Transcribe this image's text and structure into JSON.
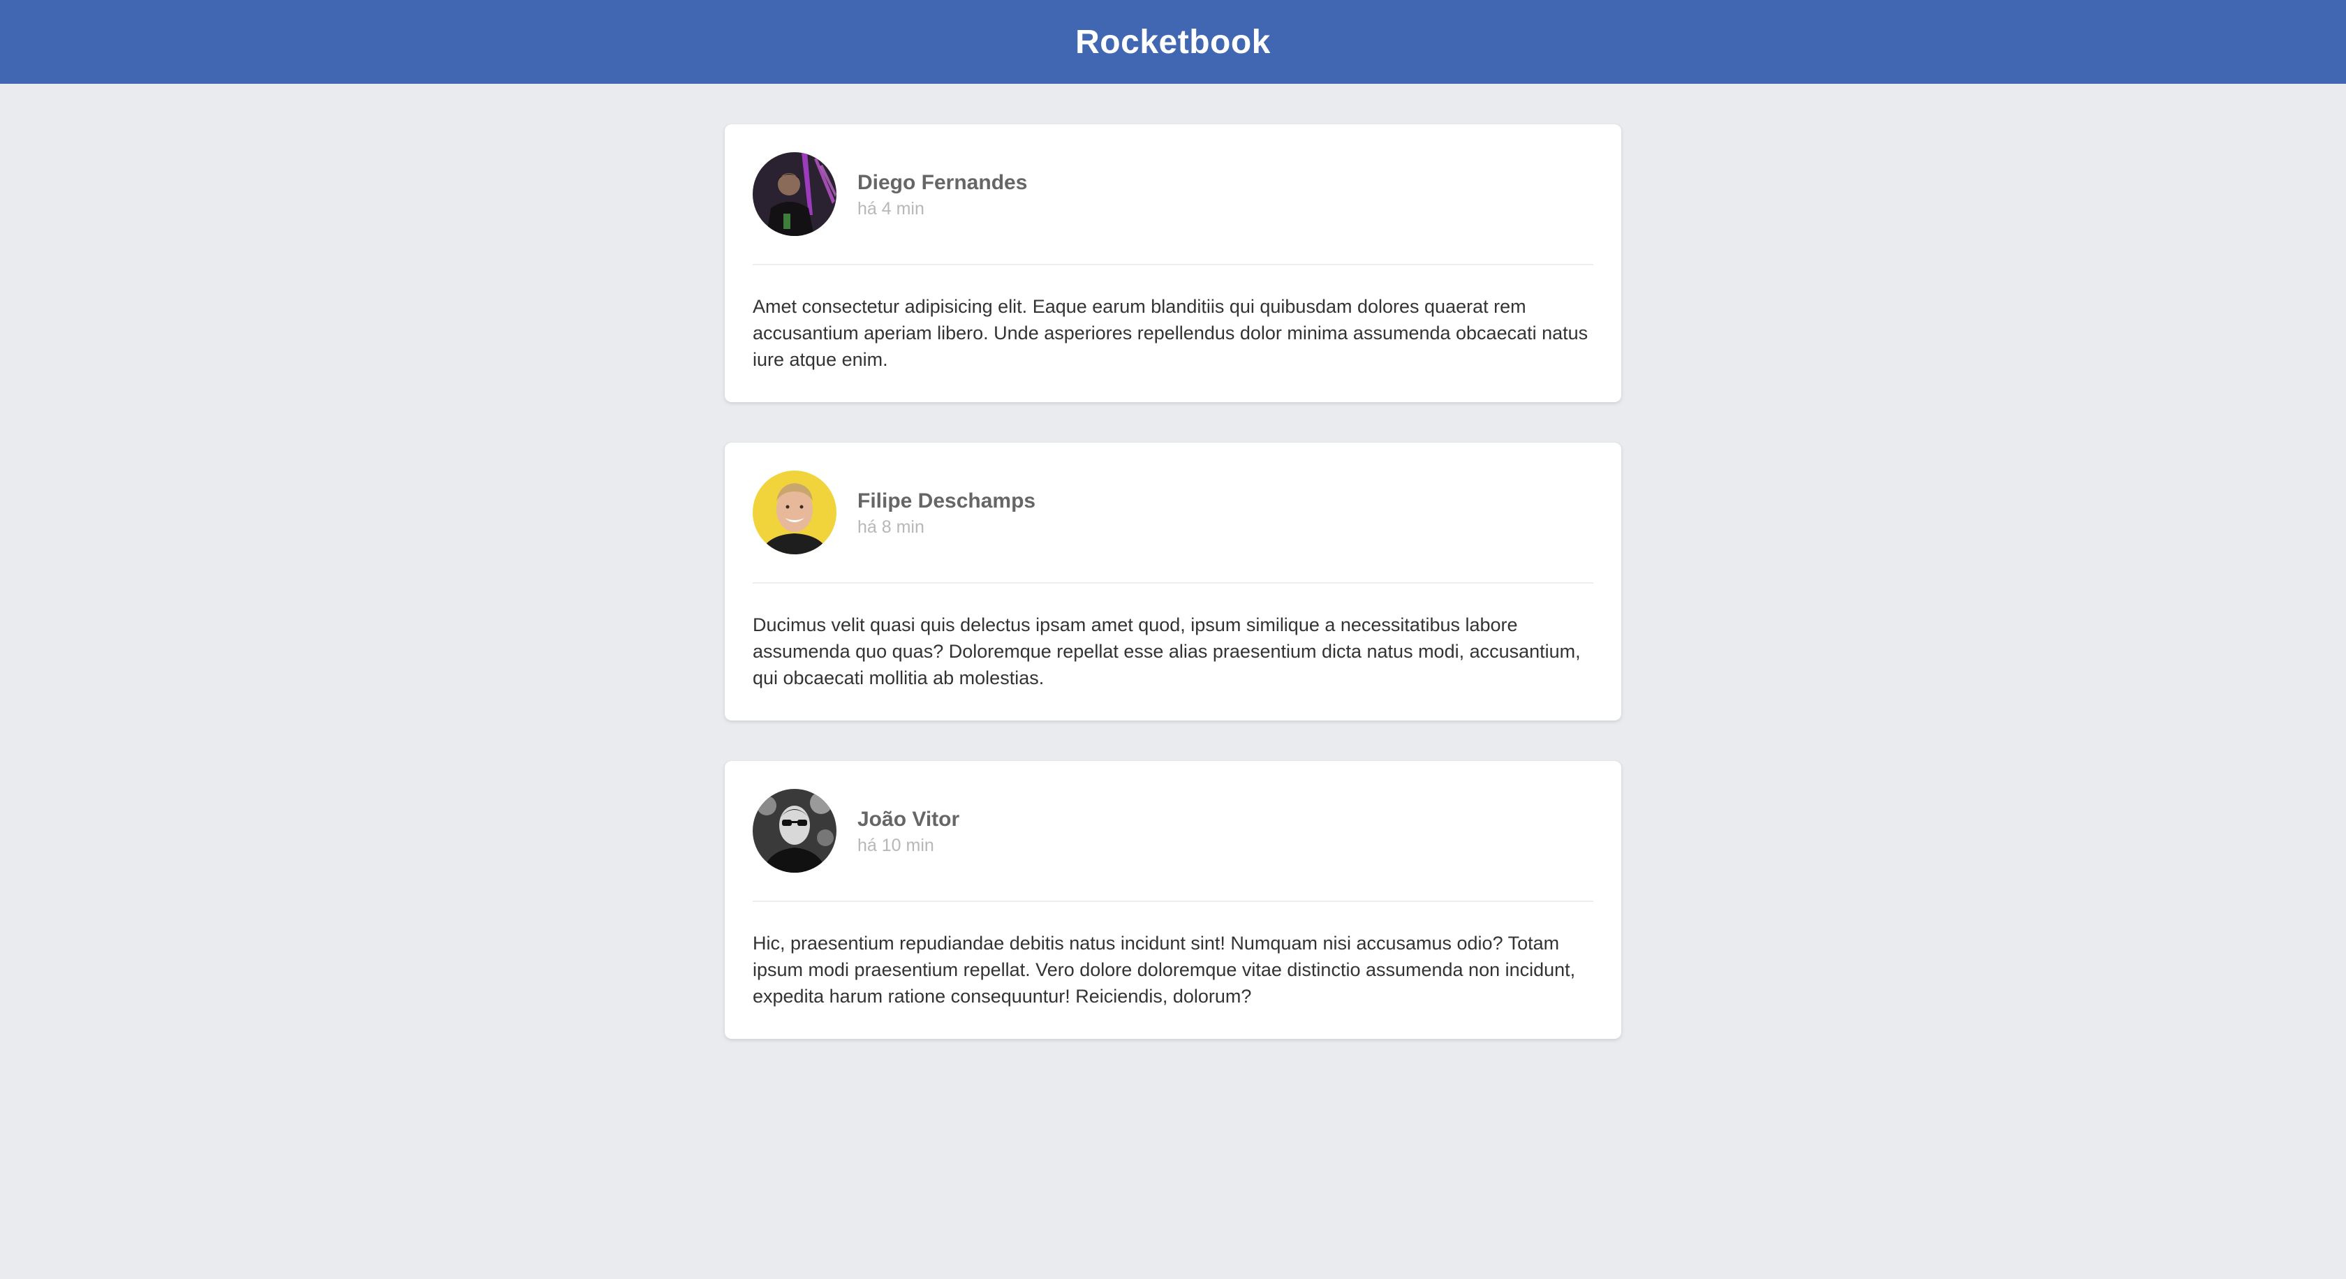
{
  "header": {
    "brand": "Rocketbook"
  },
  "colors": {
    "header_bg": "#4267b2",
    "page_bg": "#e9ebee",
    "card_bg": "#ffffff"
  },
  "posts": [
    {
      "author": "Diego Fernandes",
      "time": "há 4 min",
      "avatar_icon": "person-photo-purple-avatar",
      "content": "Amet consectetur adipisicing elit. Eaque earum blanditiis qui quibusdam dolores quaerat rem accusantium aperiam libero. Unde asperiores repellendus dolor minima assumenda obcaecati natus iure atque enim."
    },
    {
      "author": "Filipe Deschamps",
      "time": "há 8 min",
      "avatar_icon": "person-photo-yellow-avatar",
      "content": "Ducimus velit quasi quis delectus ipsam amet quod, ipsum similique a necessitatibus labore assumenda quo quas? Doloremque repellat esse alias praesentium dicta natus modi, accusantium, qui obcaecati mollitia ab molestias."
    },
    {
      "author": "João Vitor",
      "time": "há 10 min",
      "avatar_icon": "person-photo-bw-avatar",
      "content": "Hic, praesentium repudiandae debitis natus incidunt sint! Numquam nisi accusamus odio? Totam ipsum modi praesentium repellat. Vero dolore doloremque vitae distinctio assumenda non incidunt, expedita harum ratione consequuntur! Reiciendis, dolorum?"
    }
  ]
}
